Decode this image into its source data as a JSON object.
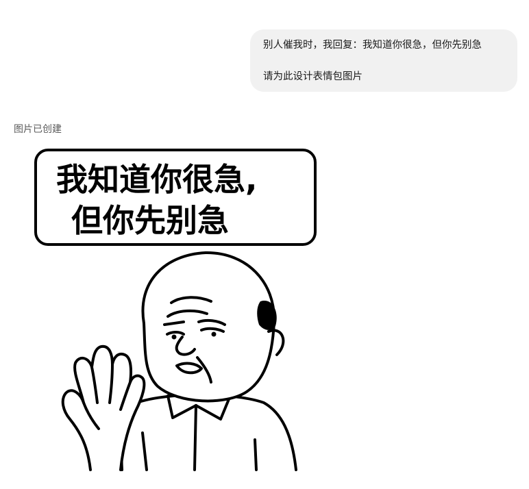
{
  "conversation": {
    "user_message": {
      "line1": "别人催我时，我回复：我知道你很急，但你先别急",
      "line2": "请为此设计表情包图片"
    },
    "assistant": {
      "status": "图片已创建",
      "image": {
        "caption_line1": "我知道你很急,",
        "caption_line2": "但你先别急",
        "icon": "meme-image"
      }
    }
  },
  "colors": {
    "bubble_bg": "#f1f1f1",
    "ink": "#000000",
    "status_text": "#5a5a5a"
  }
}
